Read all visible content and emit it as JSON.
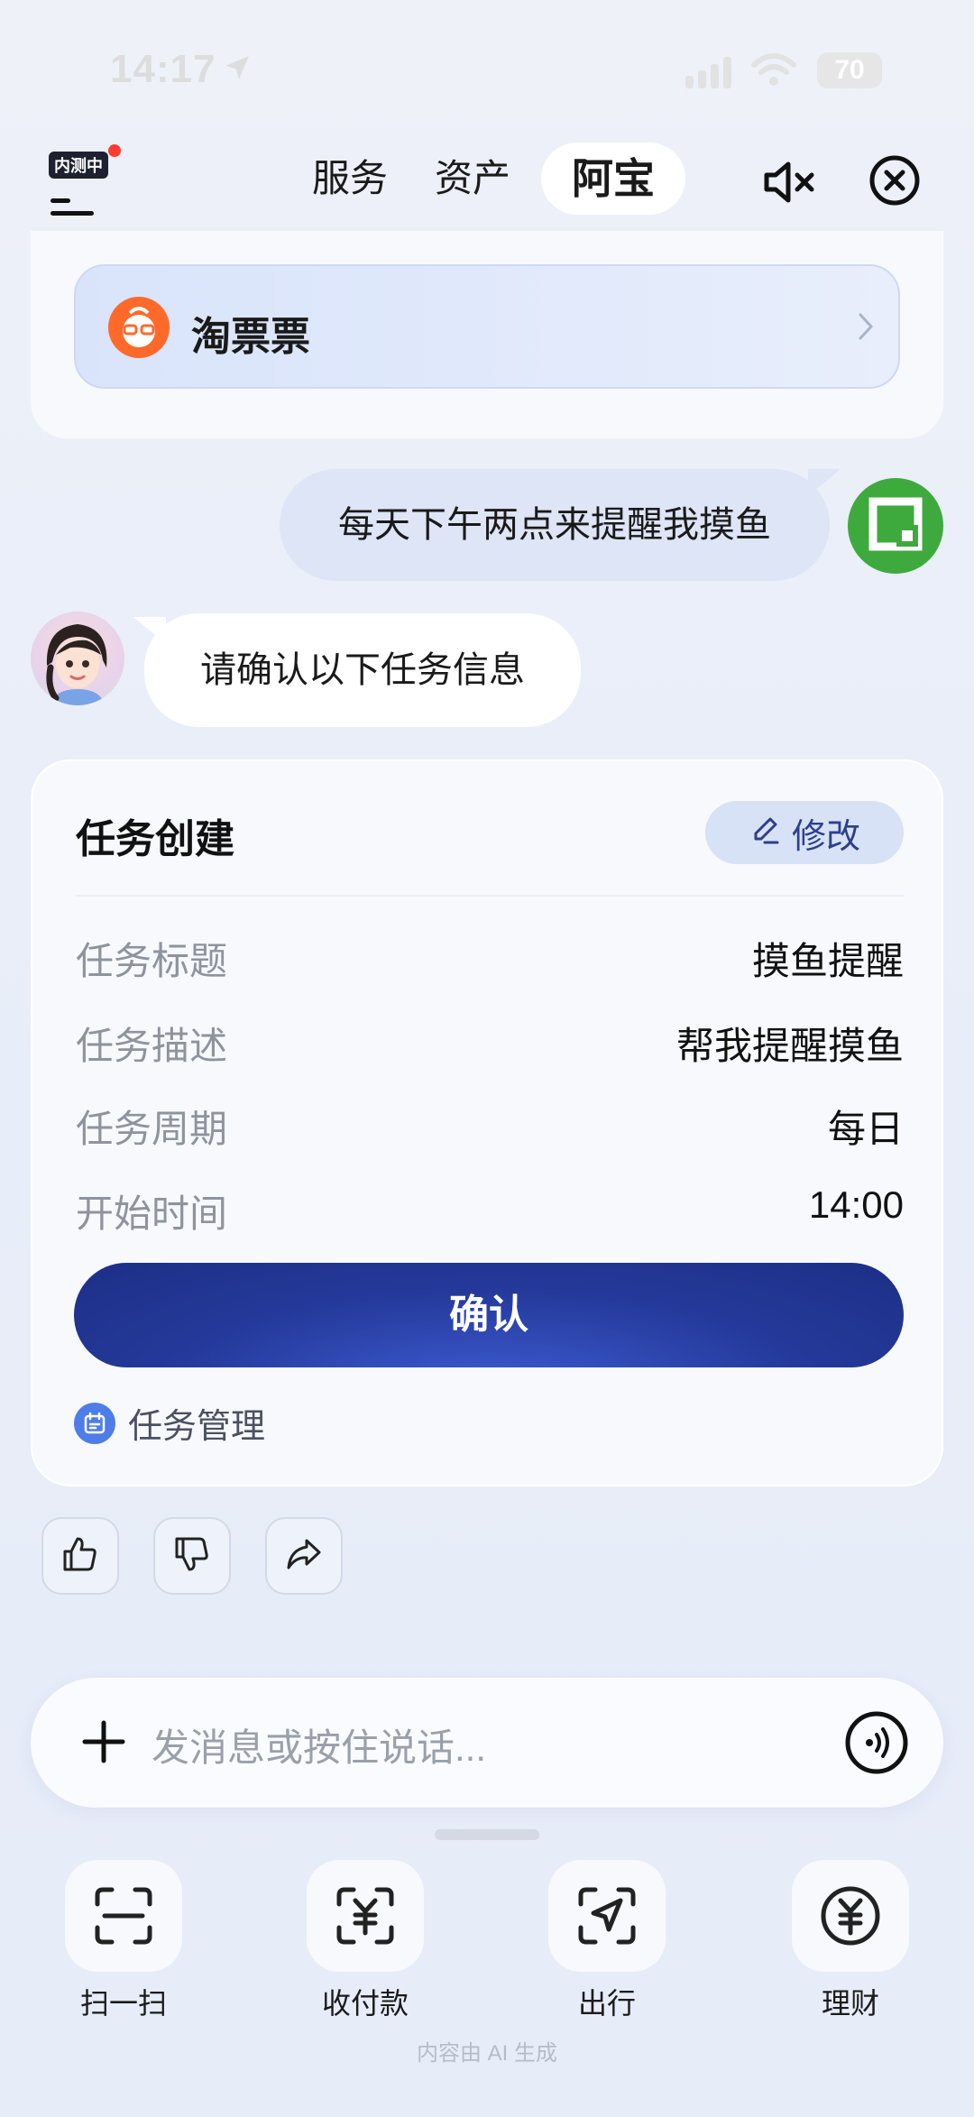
{
  "status_bar": {
    "time": "14:17",
    "battery": "70"
  },
  "header": {
    "beta_badge": "内测中",
    "tabs": [
      {
        "label": "服务"
      },
      {
        "label": "资产"
      },
      {
        "label": "阿宝"
      }
    ],
    "active_tab": "阿宝"
  },
  "top_card": {
    "mini_app_label": "淘票票"
  },
  "chat": {
    "user_message": "每天下午两点来提醒我摸鱼",
    "assistant_message": "请确认以下任务信息"
  },
  "task_card": {
    "title": "任务创建",
    "edit_label": "修改",
    "fields": [
      {
        "label": "任务标题",
        "value": "摸鱼提醒"
      },
      {
        "label": "任务描述",
        "value": "帮我提醒摸鱼"
      },
      {
        "label": "任务周期",
        "value": "每日"
      },
      {
        "label": "开始时间",
        "value": "14:00"
      }
    ],
    "confirm_label": "确认",
    "manage_label": "任务管理"
  },
  "input": {
    "placeholder": "发消息或按住说话..."
  },
  "quick_actions": [
    {
      "label": "扫一扫",
      "icon": "scan-icon"
    },
    {
      "label": "收付款",
      "icon": "payment-icon"
    },
    {
      "label": "出行",
      "icon": "travel-icon"
    },
    {
      "label": "理财",
      "icon": "finance-icon"
    }
  ],
  "footer": {
    "note": "内容由 AI 生成"
  },
  "colors": {
    "primary": "#24399a",
    "accent_blue": "#4f7de8",
    "user_bubble": "#dde5f6"
  }
}
